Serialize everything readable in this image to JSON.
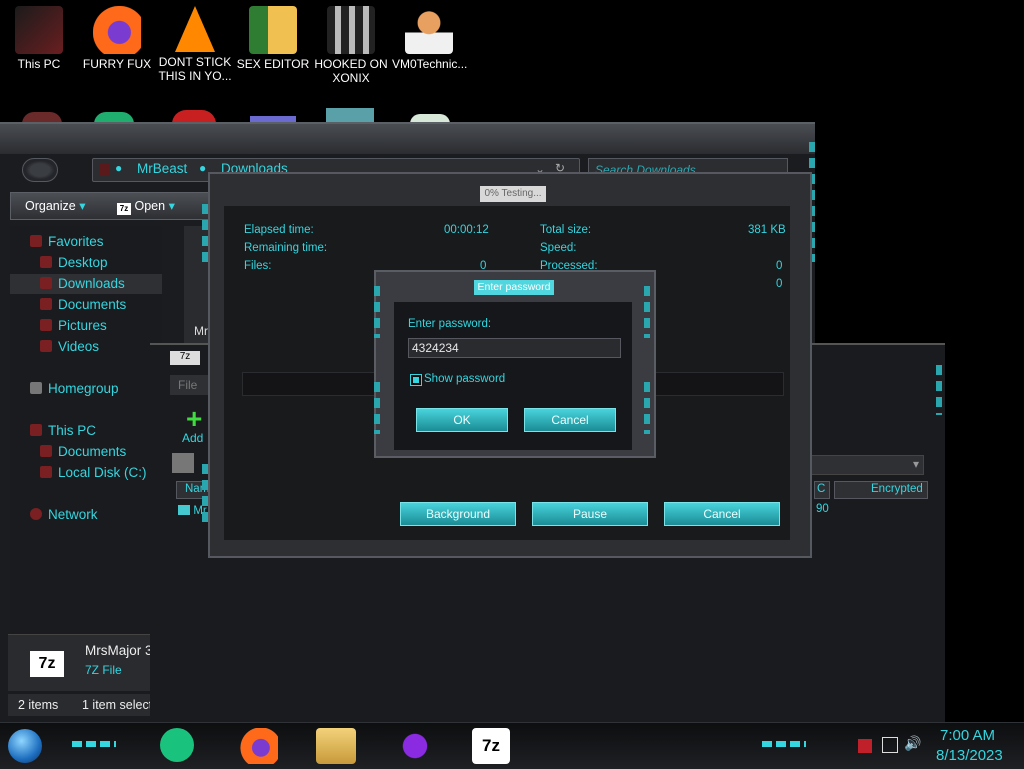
{
  "desktop_icons": [
    {
      "label": "This PC",
      "icon": "this-pc-icon",
      "color": "#4a1a1c"
    },
    {
      "label": "FURRY FUX",
      "icon": "firefox-icon",
      "color": "#e8761b"
    },
    {
      "label": "DONT STICK THIS IN YO...",
      "icon": "vlc-cone-icon",
      "color": "#ff8800"
    },
    {
      "label": "SEX EDITOR",
      "icon": "hxd-icon",
      "color": "#f0c050"
    },
    {
      "label": "HOOKED ON XONIX",
      "icon": "xonix-game-icon",
      "color": "#8a8a8a"
    },
    {
      "label": "VM0Technic...",
      "icon": "doctor-icon",
      "color": "#e8a060"
    }
  ],
  "explorer": {
    "breadcrumb": [
      "MrBeast",
      "Downloads"
    ],
    "search_placeholder": "Search Downloads",
    "toolbar": {
      "organize": "Organize",
      "open": "Open"
    },
    "nav": {
      "favorites": "Favorites",
      "desktop": "Desktop",
      "downloads": "Downloads",
      "documents": "Documents",
      "pictures": "Pictures",
      "videos": "Videos",
      "homegroup": "Homegroup",
      "this_pc": "This PC",
      "pc_documents": "Documents",
      "local_disk": "Local Disk (C:)",
      "network": "Network"
    },
    "list_partial": "Mrs",
    "details": {
      "name": "MrsMajor 3",
      "type": "7Z File"
    },
    "status": {
      "items": "2 items",
      "selected": "1 item selecte"
    }
  },
  "win2": {
    "title": "7z",
    "menu_file": "File",
    "add_label": "Add",
    "col_name": "Nam",
    "row_partial": "Mr",
    "col_c": "C",
    "col_encrypted": "Encrypted",
    "value_90": "90"
  },
  "progress_dialog": {
    "title": "0% Testing...",
    "elapsed_label": "Elapsed time:",
    "elapsed_value": "00:00:12",
    "remaining_label": "Remaining time:",
    "files_label": "Files:",
    "files_value": "0",
    "total_label": "Total size:",
    "total_value": "381 KB",
    "speed_label": "Speed:",
    "processed_label": "Processed:",
    "processed_value": "0",
    "extra_value": "0",
    "btn_background": "Background",
    "btn_pause": "Pause",
    "btn_cancel": "Cancel"
  },
  "password_dialog": {
    "title": "Enter password",
    "prompt": "Enter password:",
    "value": "4324234",
    "show_password": "Show password",
    "ok": "OK",
    "cancel": "Cancel"
  },
  "taskbar": {
    "time": "7:00 AM",
    "date": "8/13/2023",
    "apps": [
      "start-orb-icon",
      "messaging-app-icon",
      "firefox-icon",
      "file-explorer-icon",
      "infinity-app-icon",
      "7zip-icon"
    ]
  },
  "colors": {
    "accent": "#34d6e0",
    "frame": "#4a4d52",
    "background": "#000000"
  }
}
